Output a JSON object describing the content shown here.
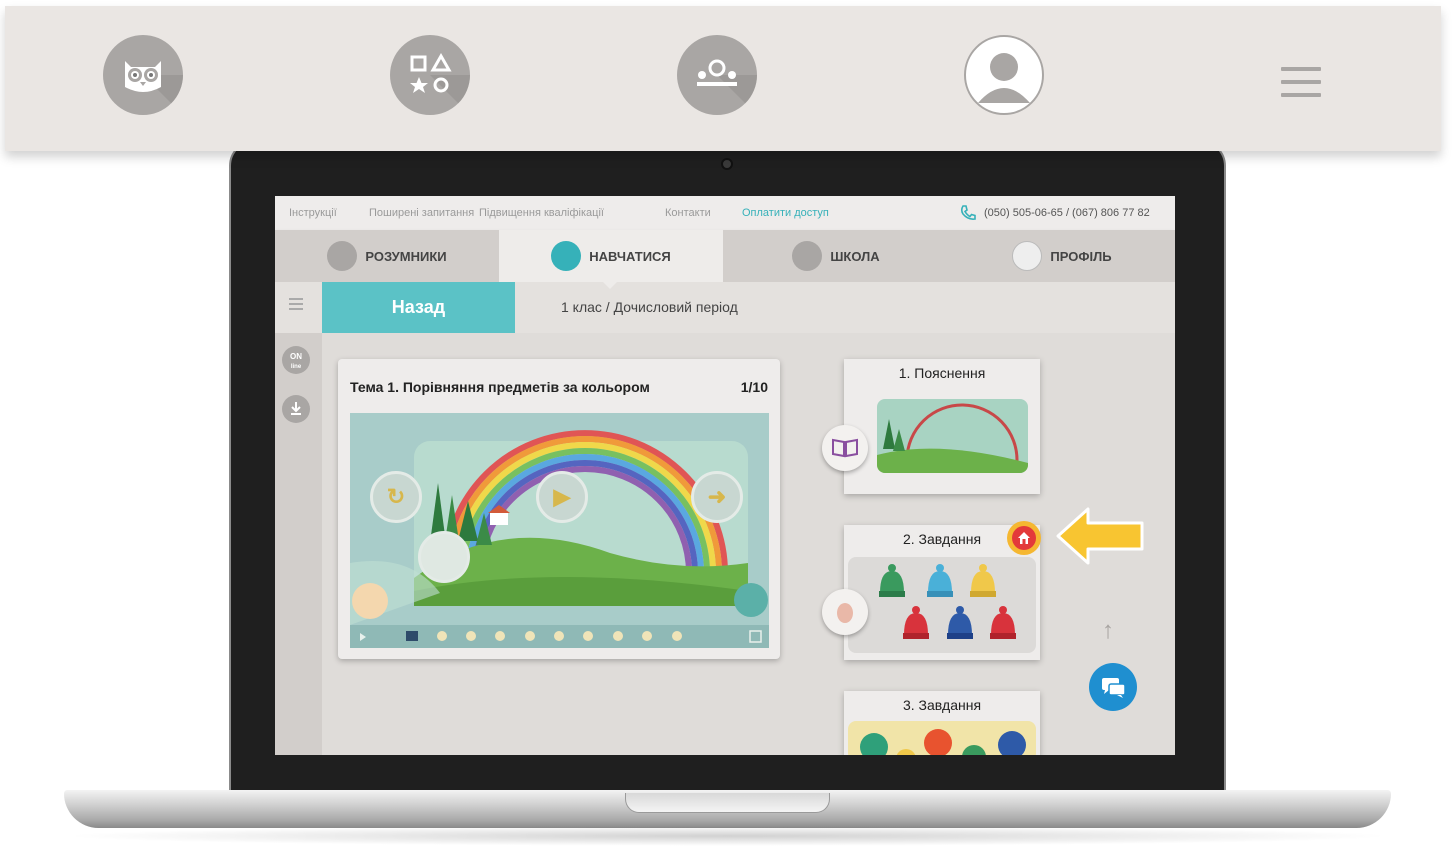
{
  "top_nav": {
    "icons": [
      "owl-icon",
      "shapes-icon",
      "school-icon",
      "profile-icon"
    ],
    "menu_icon": "hamburger-menu-icon"
  },
  "site_top_links": {
    "instructions": "Інструкції",
    "faq": "Поширені запитання",
    "qualification": "Підвищення кваліфікації",
    "contacts": "Контакти",
    "pay_access": "Оплатити доступ",
    "phone": "(050) 505-06-65 / (067) 806 77 82"
  },
  "main_tabs": [
    {
      "label": "РОЗУМНИКИ",
      "icon": "owl-icon",
      "active": false
    },
    {
      "label": "НАВЧАТИСЯ",
      "icon": "shapes-icon",
      "active": true
    },
    {
      "label": "ШКОЛА",
      "icon": "school-icon",
      "active": false
    },
    {
      "label": "ПРОФІЛЬ",
      "icon": "profile-icon",
      "active": false
    }
  ],
  "subbar": {
    "back_label": "Назад",
    "breadcrumb": "1 клас / Дочисловий період"
  },
  "sidebar": {
    "online_label_1": "ON",
    "online_label_2": "line",
    "download_icon": "download-icon"
  },
  "lesson": {
    "title": "Тема 1. Порівняння предметів за кольором",
    "counter": "1/10"
  },
  "tasks": [
    {
      "title": "1. Пояснення",
      "badge_icon": "book-icon"
    },
    {
      "title": "2. Завдання",
      "badge_icon": "egg-icon",
      "marker_icon": "home-icon"
    },
    {
      "title": "3. Завдання"
    }
  ],
  "colors": {
    "accent_teal": "#36b1b9",
    "back_button": "#5bc2c6",
    "chat_button": "#1f8fd0",
    "highlight_arrow": "#f8c531",
    "home_marker": "#e33a3a"
  }
}
